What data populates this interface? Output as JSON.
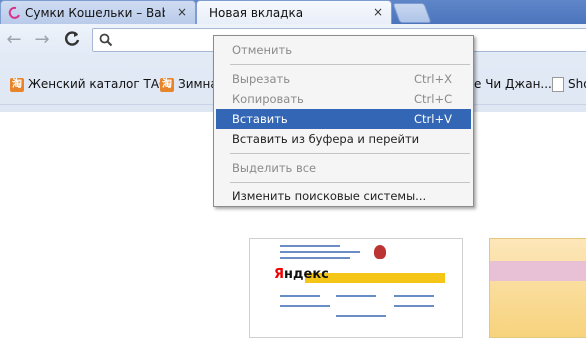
{
  "tabs": [
    {
      "label": "Сумки Кошельки – BabyBlog",
      "close": "×",
      "active": false
    },
    {
      "label": "Новая вкладка",
      "close": "×",
      "active": true
    }
  ],
  "toolbar": {
    "back_icon": "←",
    "forward_icon": "→",
    "reload_icon": "C",
    "search_icon": "search-icon",
    "omnibox_value": ""
  },
  "bookmarks": [
    {
      "label": "Женский каталог ТАО",
      "icon": "淘"
    },
    {
      "label": "Зимна-",
      "icon": "淘"
    },
    {
      "label": "е Чи Джан..."
    },
    {
      "label": "Sho"
    }
  ],
  "context_menu": {
    "items": [
      {
        "label": "Отменить",
        "shortcut": "",
        "disabled": true
      },
      {
        "label": "Вырезать",
        "shortcut": "Ctrl+X",
        "disabled": true
      },
      {
        "label": "Копировать",
        "shortcut": "Ctrl+C",
        "disabled": true
      },
      {
        "label": "Вставить",
        "shortcut": "Ctrl+V",
        "disabled": false,
        "highlighted": true
      },
      {
        "label": "Вставить из буфера и перейти",
        "shortcut": "",
        "disabled": false
      },
      {
        "label": "Выделить все",
        "shortcut": "",
        "disabled": true
      },
      {
        "label": "Изменить поисковые системы...",
        "shortcut": "",
        "disabled": false
      }
    ]
  },
  "thumbnails": {
    "yandex_logo": "Яндекс"
  },
  "colors": {
    "menu_highlight": "#3366b5",
    "tab_strip": "#5f86c8"
  }
}
